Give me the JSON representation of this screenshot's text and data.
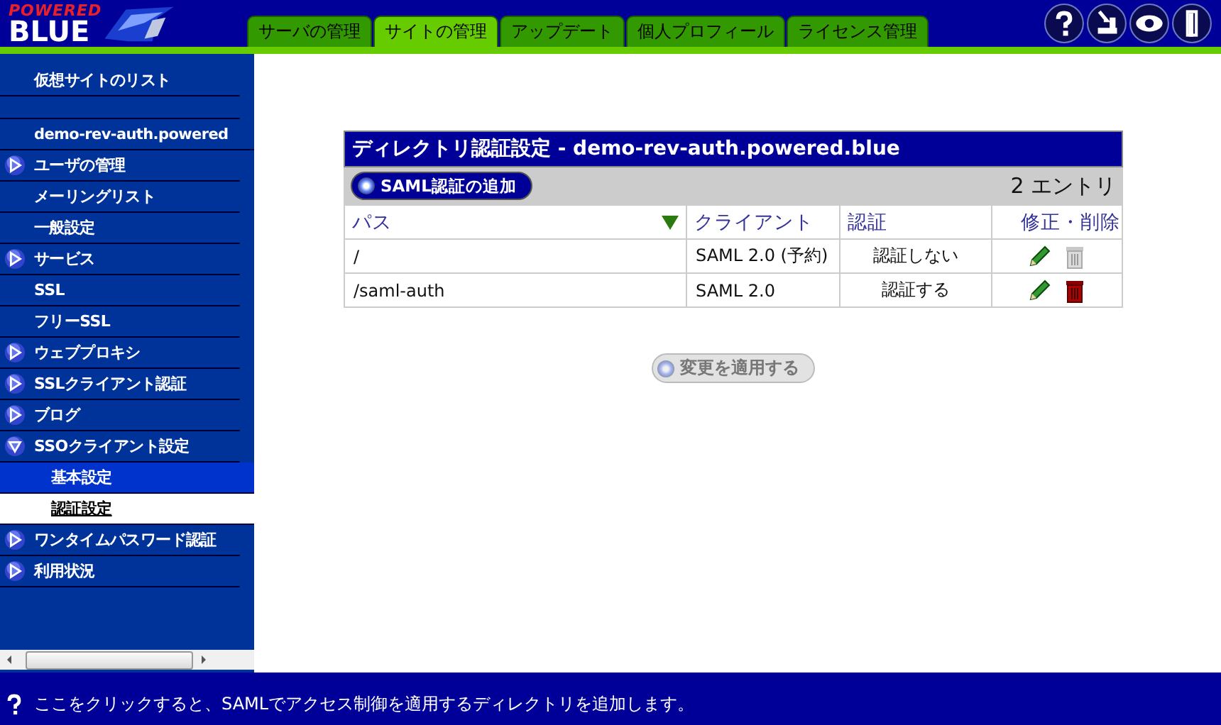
{
  "logo": {
    "top": "POWERED",
    "bottom": "BLUE"
  },
  "tabs": [
    {
      "label": "サーバの管理",
      "selected": false
    },
    {
      "label": "サイトの管理",
      "selected": true
    },
    {
      "label": "アップデート",
      "selected": false
    },
    {
      "label": "個人プロフィール",
      "selected": false
    },
    {
      "label": "ライセンス管理",
      "selected": false
    }
  ],
  "sidebar": {
    "title": "仮想サイトのリスト",
    "site": "demo-rev-auth.powered",
    "items": [
      {
        "label": "ユーザの管理",
        "kind": "group",
        "expanded": false
      },
      {
        "label": "メーリングリスト",
        "kind": "link",
        "expanded": false
      },
      {
        "label": "一般設定",
        "kind": "link",
        "expanded": false
      },
      {
        "label": "サービス",
        "kind": "group",
        "expanded": false
      },
      {
        "label": "SSL",
        "kind": "link",
        "expanded": false
      },
      {
        "label": "フリーSSL",
        "kind": "link",
        "expanded": false
      },
      {
        "label": "ウェブプロキシ",
        "kind": "group",
        "expanded": false
      },
      {
        "label": "SSLクライアント認証",
        "kind": "group",
        "expanded": false
      },
      {
        "label": "ブログ",
        "kind": "group",
        "expanded": false
      },
      {
        "label": "SSOクライアント設定",
        "kind": "group",
        "expanded": true,
        "children": [
          {
            "label": "基本設定",
            "selected": false,
            "hovered": true
          },
          {
            "label": "認証設定",
            "selected": true,
            "hovered": false
          }
        ]
      },
      {
        "label": "ワンタイムパスワード認証",
        "kind": "group",
        "expanded": false
      },
      {
        "label": "利用状況",
        "kind": "group",
        "expanded": false
      }
    ]
  },
  "panel": {
    "title": "ディレクトリ認証設定 - demo-rev-auth.powered.blue",
    "add_button": "SAML認証の追加",
    "count": "2 エントリ",
    "columns": [
      "パス",
      "クライアント",
      "認証",
      "修正・削除"
    ],
    "rows": [
      {
        "path": "/",
        "client": "SAML 2.0 (予約)",
        "auth": "認証しない",
        "deletable": false
      },
      {
        "path": "/saml-auth",
        "client": "SAML 2.0",
        "auth": "認証する",
        "deletable": true
      }
    ],
    "apply_button": {
      "label": "変更を適用する",
      "disabled": true
    }
  },
  "status_bar": "ここをクリックすると、SAMLでアクセス制御を適用するディレクトリを追加します。"
}
